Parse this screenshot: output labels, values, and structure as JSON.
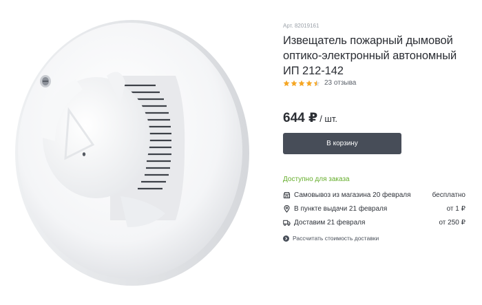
{
  "product": {
    "article": "Арт. 82019161",
    "title": "Извещатель пожарный дымовой оптико-электронный автономный ИП 212-142",
    "rating": 4.5,
    "reviews": "23 отзыва",
    "price": "644 ₽",
    "price_unit": "/ шт.",
    "cart_label": "В корзину",
    "availability": "Доступно для заказа",
    "delivery": [
      {
        "label": "Самовывоз из магазина 20 февраля",
        "cost": "бесплатно",
        "icon": "shop-icon"
      },
      {
        "label": "В пункте выдачи 21 февраля",
        "cost": "от 1 ₽",
        "icon": "location-pin-icon"
      },
      {
        "label": "Доставим 21 февраля",
        "cost": "от 250 ₽",
        "icon": "truck-icon"
      }
    ],
    "calc_link": "Рассчитать стоимость доставки",
    "colors": {
      "accent_green": "#64ad2a",
      "button": "#474d58",
      "star": "#f5a623"
    }
  }
}
